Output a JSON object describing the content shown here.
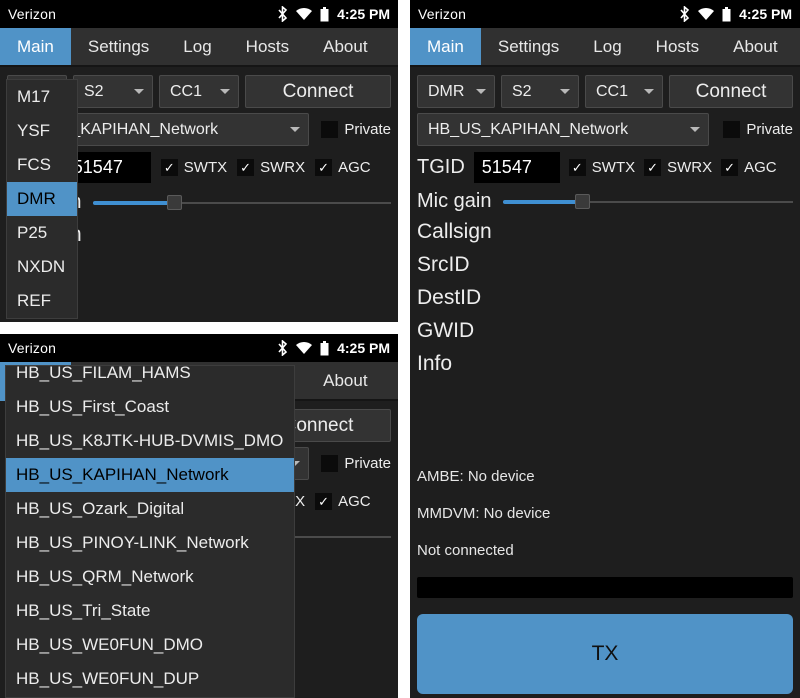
{
  "status_bar": {
    "carrier": "Verizon",
    "time": "4:25 PM",
    "icons": [
      "bluetooth-icon",
      "wifi-icon",
      "battery-icon"
    ]
  },
  "tabs": [
    {
      "label": "Main",
      "active": true
    },
    {
      "label": "Settings",
      "active": false
    },
    {
      "label": "Log",
      "active": false
    },
    {
      "label": "Hosts",
      "active": false
    },
    {
      "label": "About",
      "active": false
    }
  ],
  "controls": {
    "mode_value": "DMR",
    "slot_value": "S2",
    "cc_value": "CC1",
    "connect_label": "Connect",
    "host_value": "HB_US_KAPIHAN_Network",
    "private_label": "Private",
    "private_checked": false,
    "tgid_label": "TGID",
    "tgid_value": "51547",
    "swtx_label": "SWTX",
    "swtx_checked": true,
    "swrx_label": "SWRX",
    "swrx_checked": true,
    "agc_label": "AGC",
    "agc_checked": true,
    "mic_gain_label": "Mic gain",
    "mic_gain_percent": 27
  },
  "fields": [
    {
      "label": "Callsign",
      "value": ""
    },
    {
      "label": "SrcID",
      "value": ""
    },
    {
      "label": "DestID",
      "value": ""
    },
    {
      "label": "GWID",
      "value": ""
    },
    {
      "label": "Info",
      "value": ""
    }
  ],
  "status": {
    "ambe": "AMBE: No device",
    "mmdvm": "MMDVM: No device",
    "connection": "Not connected"
  },
  "tx_button_label": "TX",
  "mode_dropdown": {
    "items": [
      "M17",
      "YSF",
      "FCS",
      "DMR",
      "P25",
      "NXDN",
      "REF"
    ],
    "selected": "DMR"
  },
  "host_dropdown": {
    "items": [
      "HB_US_FILAM_HAMS",
      "HB_US_First_Coast",
      "HB_US_K8JTK-HUB-DVMIS_DMO",
      "HB_US_KAPIHAN_Network",
      "HB_US_Ozark_Digital",
      "HB_US_PINOY-LINK_Network",
      "HB_US_QRM_Network",
      "HB_US_Tri_State",
      "HB_US_WE0FUN_DMO",
      "HB_US_WE0FUN_DUP"
    ],
    "selected": "HB_US_KAPIHAN_Network"
  },
  "colors": {
    "accent": "#5093c7",
    "panel_bg": "#1e1e1e",
    "tabbar_bg": "#303030",
    "statusbar_bg": "#000000",
    "slider_fill": "#3f8fd2"
  }
}
